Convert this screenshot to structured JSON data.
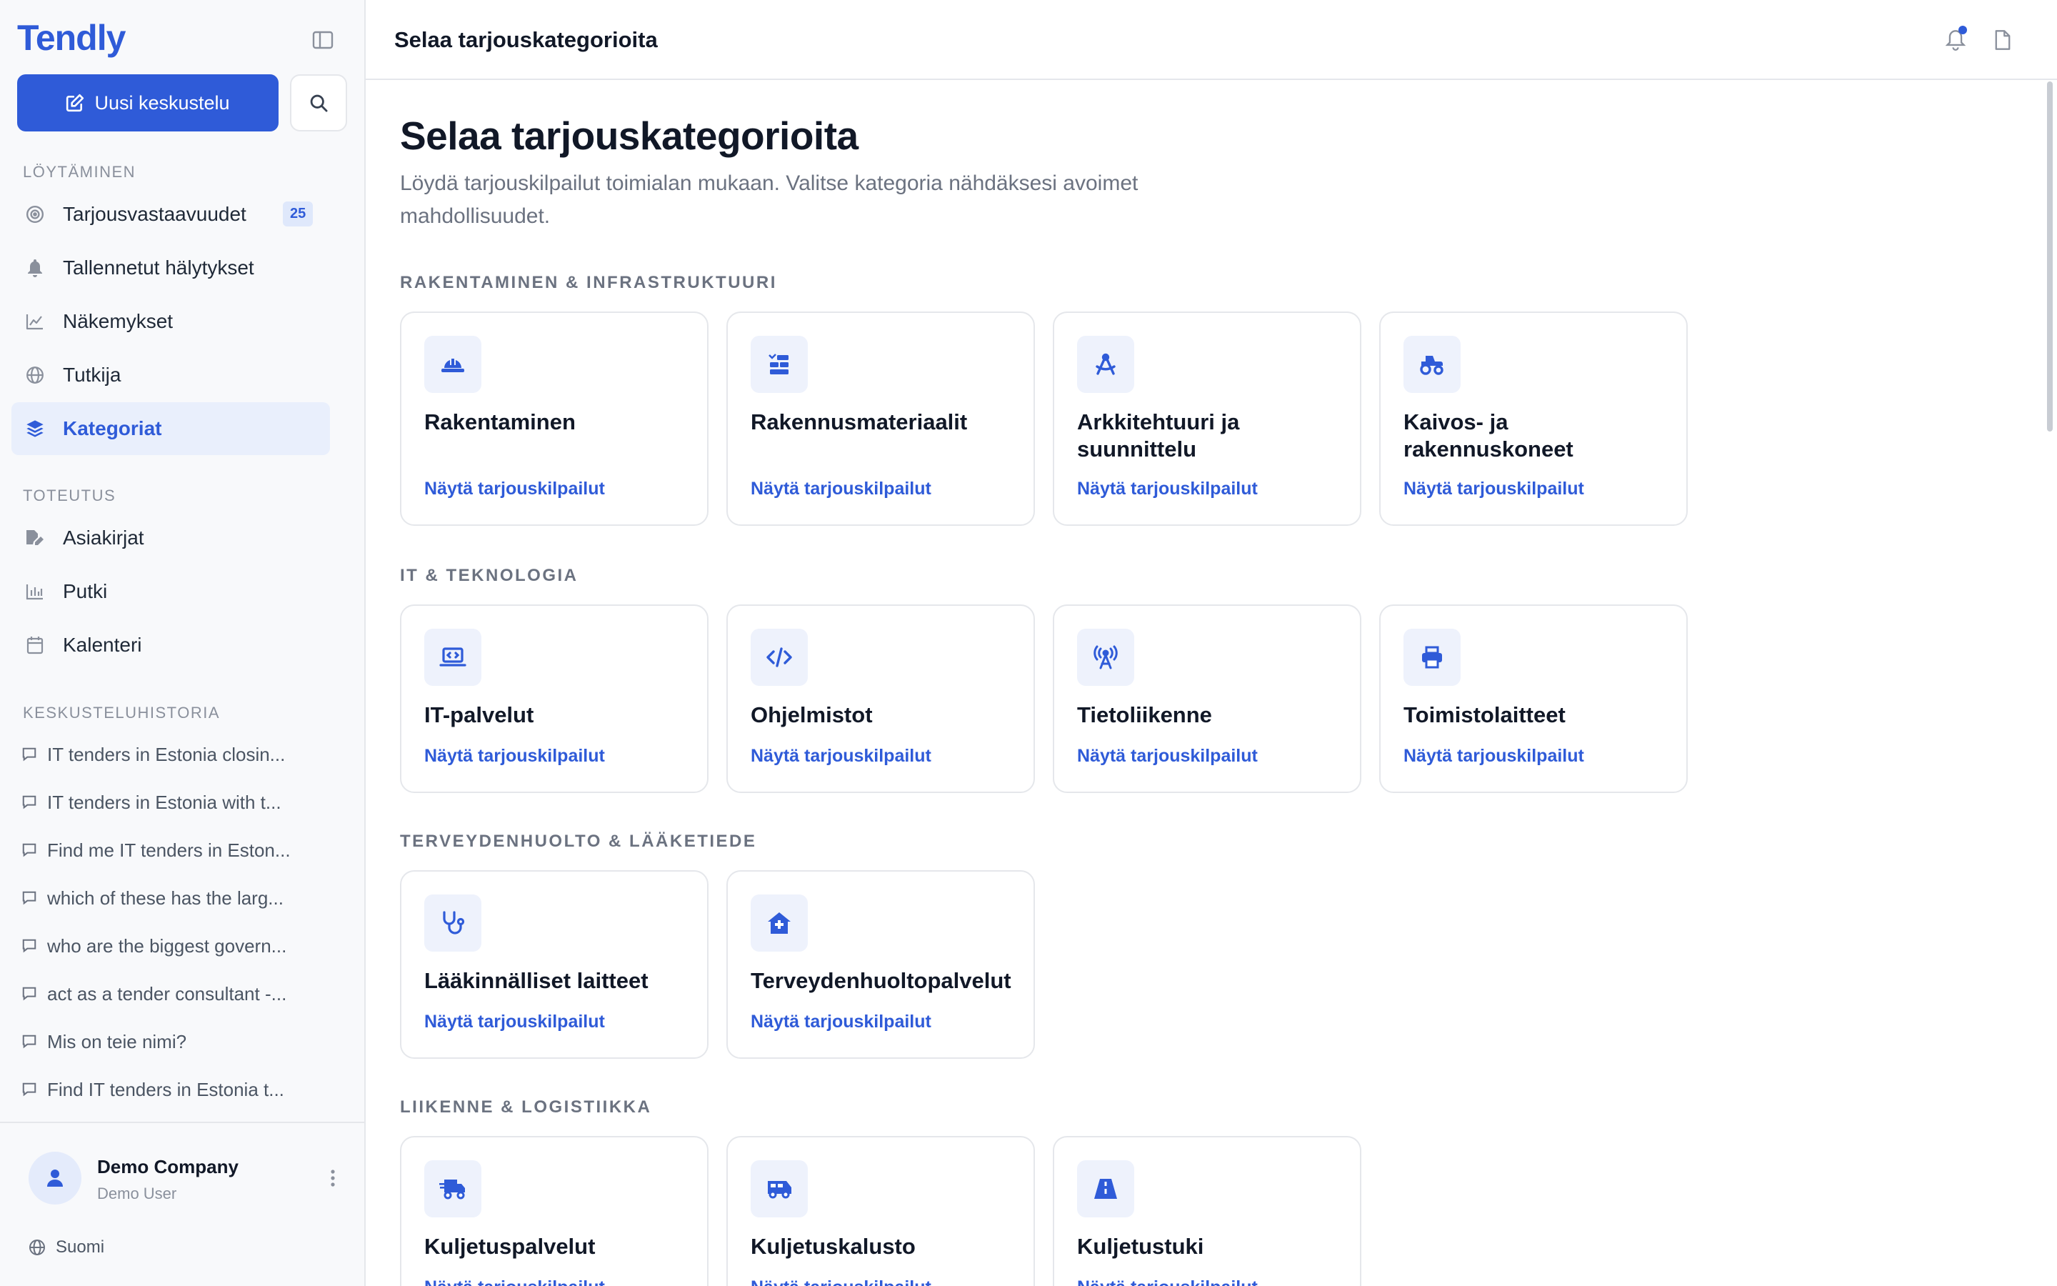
{
  "app": {
    "brand": "Tendly"
  },
  "sidebar": {
    "new_chat_label": "Uusi keskustelu",
    "sections": {
      "discovery": "LÖYTÄMINEN",
      "execution": "TOTEUTUS",
      "history": "KESKUSTELUHISTORIA"
    },
    "discovery_items": [
      {
        "label": "Tarjousvastaavuudet",
        "icon": "target-icon",
        "badge": "25"
      },
      {
        "label": "Tallennetut hälytykset",
        "icon": "bell-icon"
      },
      {
        "label": "Näkemykset",
        "icon": "line-chart-icon"
      },
      {
        "label": "Tutkija",
        "icon": "globe-icon"
      },
      {
        "label": "Kategoriat",
        "icon": "layers-icon",
        "active": true
      }
    ],
    "execution_items": [
      {
        "label": "Asiakirjat",
        "icon": "document-edit-icon"
      },
      {
        "label": "Putki",
        "icon": "bar-chart-icon"
      },
      {
        "label": "Kalenteri",
        "icon": "calendar-icon"
      }
    ],
    "history": [
      "IT tenders in Estonia closin...",
      "IT tenders in Estonia with t...",
      "Find me IT tenders in Eston...",
      "which of these has the larg...",
      "who are the biggest govern...",
      "act as a tender consultant -...",
      "Mis on teie nimi?",
      "Find IT tenders in Estonia t..."
    ],
    "footer": {
      "company": "Demo Company",
      "user": "Demo User",
      "language": "Suomi"
    }
  },
  "topbar": {
    "title": "Selaa tarjouskategorioita"
  },
  "main": {
    "title": "Selaa tarjouskategorioita",
    "description": "Löydä tarjouskilpailut toimialan mukaan. Valitse kategoria nähdäksesi avoimet mahdollisuudet.",
    "link_label": "Näytä tarjouskilpailut",
    "categories": [
      {
        "title": "RAKENTAMINEN & INFRASTRUKTUURI",
        "cards": [
          {
            "name": "Rakentaminen",
            "icon": "hard-hat-icon"
          },
          {
            "name": "Rakennusmateriaalit",
            "icon": "building-materials-icon"
          },
          {
            "name": "Arkkitehtuuri ja suunnittelu",
            "icon": "compass-drafting-icon"
          },
          {
            "name": "Kaivos- ja rakennuskoneet",
            "icon": "tractor-icon"
          }
        ]
      },
      {
        "title": "IT & TEKNOLOGIA",
        "cards": [
          {
            "name": "IT-palvelut",
            "icon": "laptop-code-icon"
          },
          {
            "name": "Ohjelmistot",
            "icon": "code-icon"
          },
          {
            "name": "Tietoliikenne",
            "icon": "tower-broadcast-icon"
          },
          {
            "name": "Toimistolaitteet",
            "icon": "printer-icon"
          }
        ]
      },
      {
        "title": "TERVEYDENHUOLTO & LÄÄKETIEDE",
        "cards": [
          {
            "name": "Lääkinnälliset laitteet",
            "icon": "stethoscope-icon"
          },
          {
            "name": "Terveydenhuoltopalvelut",
            "icon": "house-medical-icon"
          }
        ]
      },
      {
        "title": "LIIKENNE & LOGISTIIKKA",
        "cards": [
          {
            "name": "Kuljetuspalvelut",
            "icon": "truck-fast-icon"
          },
          {
            "name": "Kuljetuskalusto",
            "icon": "van-icon"
          },
          {
            "name": "Kuljetustuki",
            "icon": "road-icon"
          }
        ]
      }
    ]
  },
  "colors": {
    "accent": "#2f5bd8",
    "accent_soft": "#e9effc",
    "text": "#111827",
    "muted": "#6b7280",
    "border": "#e5e7eb",
    "sidebar_bg": "#f8f9fb"
  }
}
